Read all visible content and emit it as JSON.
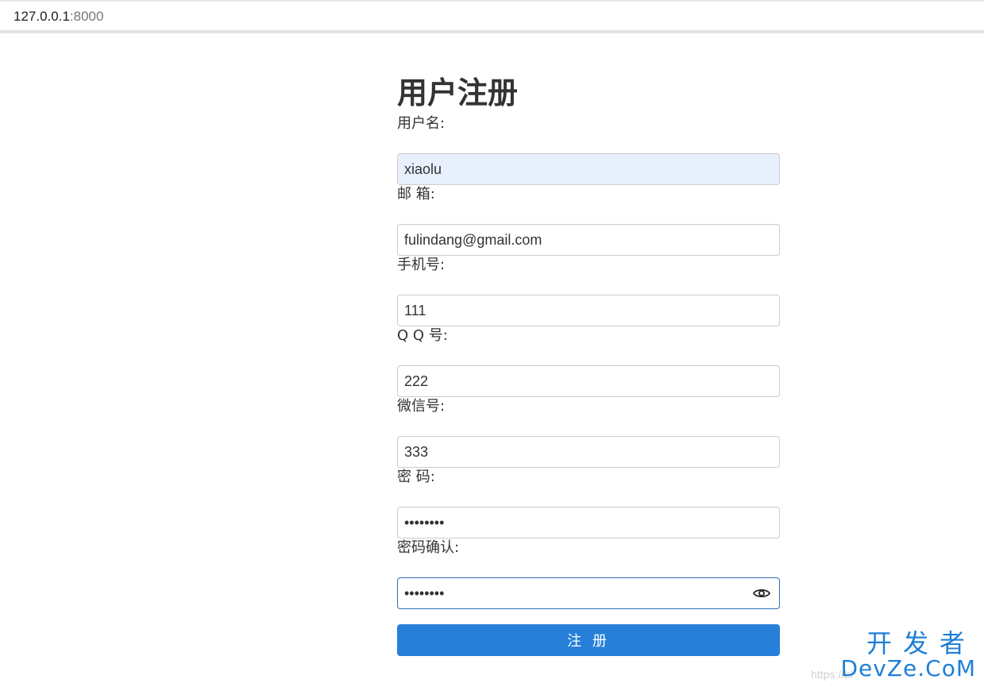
{
  "browser": {
    "url_host": "127.0.0.1",
    "url_port": ":8000"
  },
  "form": {
    "title": "用户注册",
    "fields": [
      {
        "label": "用户名:",
        "value": "xiaolu"
      },
      {
        "label": "邮 箱:",
        "value": "fulindang@gmail.com"
      },
      {
        "label": "手机号:",
        "value": "111"
      },
      {
        "label": "Q Q 号:",
        "value": "222"
      },
      {
        "label": "微信号:",
        "value": "333"
      },
      {
        "label": "密 码:",
        "value": "••••••••"
      },
      {
        "label": "密码确认:",
        "value": "••••••••"
      }
    ],
    "submit_label": "注 册"
  },
  "watermark": {
    "top": "开发者",
    "bottom": "DevZe.CoM",
    "faint": "https://bl"
  },
  "icons": {
    "reveal_password": "eye-icon"
  },
  "colors": {
    "primary": "#2680d9",
    "autofill": "#e8f0fe",
    "focus_border": "#2a6fb8"
  }
}
